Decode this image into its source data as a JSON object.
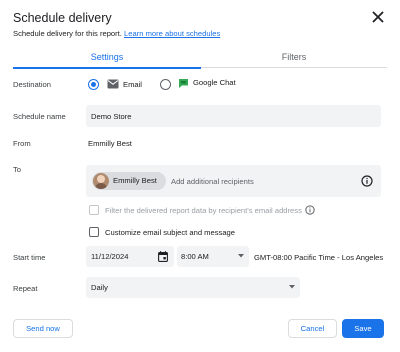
{
  "dialog": {
    "title": "Schedule delivery",
    "subtitle": "Schedule delivery for this report.",
    "learn_more": "Learn more about schedules"
  },
  "tabs": [
    {
      "label": "Settings",
      "active": true
    },
    {
      "label": "Filters",
      "active": false
    }
  ],
  "destination": {
    "label": "Destination",
    "options": [
      {
        "label": "Email",
        "selected": true,
        "icon": "email-icon"
      },
      {
        "label": "Google Chat",
        "selected": false,
        "icon": "google-chat-icon"
      }
    ]
  },
  "schedule_name": {
    "label": "Schedule name",
    "value": "Demo Store"
  },
  "from": {
    "label": "From",
    "value": "Emmilly Best"
  },
  "to": {
    "label": "To",
    "recipient": "Emmilly Best",
    "placeholder": "Add additional recipients"
  },
  "filter_checkbox": {
    "label": "Filter the delivered report data by recipient's email address",
    "checked": false,
    "disabled": true
  },
  "customize_checkbox": {
    "label": "Customize email subject and message",
    "checked": false
  },
  "start_time": {
    "label": "Start time",
    "date": "11/12/2024",
    "time": "8:00 AM",
    "timezone": "GMT-08:00 Pacific Time - Los Angeles"
  },
  "repeat": {
    "label": "Repeat",
    "value": "Daily"
  },
  "buttons": {
    "send_now": "Send now",
    "cancel": "Cancel",
    "save": "Save"
  },
  "colors": {
    "accent": "#1a73e8",
    "field_bg": "#f1f3f4",
    "google_chat": "#34a853"
  }
}
